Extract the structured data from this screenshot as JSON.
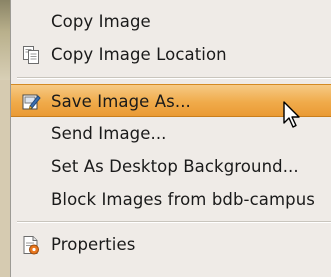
{
  "context_menu": {
    "items": [
      {
        "label": "Copy Image",
        "icon": null,
        "highlighted": false
      },
      {
        "label": "Copy Image Location",
        "icon": "copy-icon",
        "highlighted": false
      },
      {
        "label": "Save Image As...",
        "icon": "save-as-icon",
        "highlighted": true
      },
      {
        "label": "Send Image...",
        "icon": null,
        "highlighted": false
      },
      {
        "label": "Set As Desktop Background...",
        "icon": null,
        "highlighted": false
      },
      {
        "label": "Block Images from bdb-campus",
        "icon": null,
        "highlighted": false
      },
      {
        "label": "Properties",
        "icon": "properties-icon",
        "highlighted": false
      }
    ]
  },
  "colors": {
    "menu_background": "#efebe7",
    "highlight": "#f0ab4b",
    "separator": "#c9c5bd",
    "text": "#1a1a1a"
  }
}
